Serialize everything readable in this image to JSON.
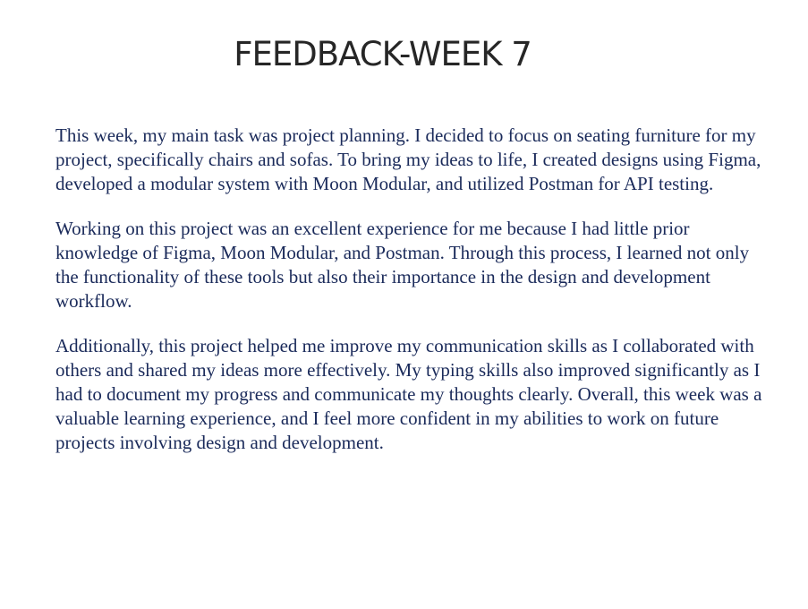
{
  "slide": {
    "title": "FEEDBACK-WEEK 7",
    "paragraphs": [
      "This week, my main task was project planning. I decided to focus on seating furniture for my project, specifically chairs and sofas. To bring my ideas to life, I created designs using Figma, developed a modular system with Moon Modular, and utilized Postman for API testing.",
      "Working on this project was an excellent experience for me because I had little prior knowledge of Figma, Moon Modular, and Postman. Through this process, I learned not only the functionality of these tools but also their importance in the design and development workflow.",
      "Additionally, this project helped me improve my communication skills as I collaborated with others and shared my ideas more effectively. My typing skills also improved significantly as I had to document my progress and communicate my thoughts clearly. Overall, this week was a valuable learning experience, and I feel more confident in my abilities to work on future projects involving design and development."
    ]
  },
  "colors": {
    "title": "#262626",
    "body_text": "#1a2a5a",
    "background": "#ffffff"
  }
}
